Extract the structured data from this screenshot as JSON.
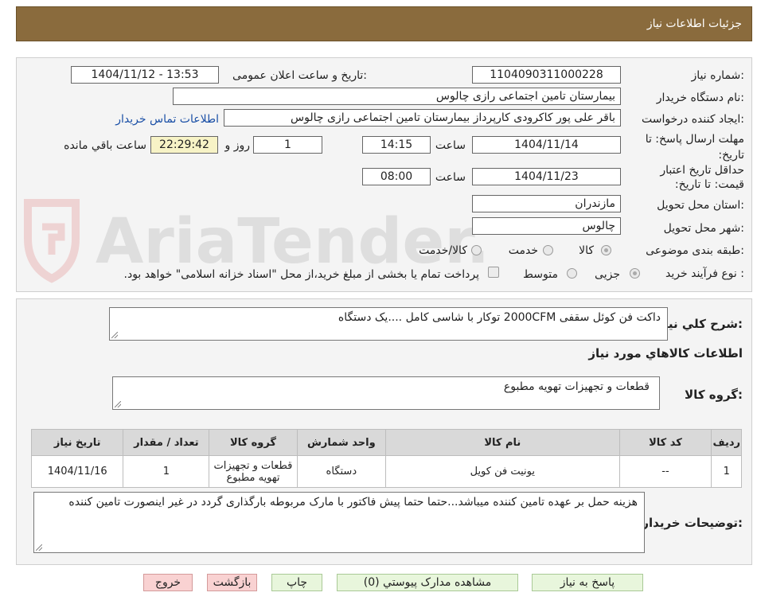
{
  "header": {
    "title": "جزئیات اطلاعات نیاز"
  },
  "watermark": {
    "text": "AriaTender.neT"
  },
  "form": {
    "need_number_label": "شماره نیاز:",
    "need_number": "1104090311000228",
    "announce_label": "تاریخ و ساعت اعلان عمومی:",
    "announce_value": "1404/11/12 - 13:53",
    "buyer_org_label": "نام دستگاه خریدار:",
    "buyer_org": "بیمارستان تامین اجتماعی رازی چالوس",
    "creator_label": "ایجاد کننده درخواست:",
    "creator": "باقر علی پور کاکرودی کارپرداز بیمارستان تامین اجتماعی رازی چالوس",
    "contact_link": "اطلاعات تماس خریدار",
    "deadline_label": "مهلت ارسال پاسخ: تا تاریخ:",
    "deadline_date": "1404/11/14",
    "time_label": "ساعت",
    "deadline_time": "14:15",
    "days": "1",
    "days_label": "روز و",
    "remaining_time": "22:29:42",
    "remaining_label": "ساعت باقي مانده",
    "validity_label": "حداقل تاریخ اعتبار قیمت: تا تاریخ:",
    "validity_date": "1404/11/23",
    "validity_time": "08:00",
    "province_label": "استان محل تحویل:",
    "province": "مازندران",
    "city_label": "شهر محل تحویل:",
    "city": "چالوس",
    "category_label": "طبقه بندی موضوعی:",
    "category_options": [
      "کالا",
      "خدمت",
      "کالا/خدمت"
    ],
    "process_label": "نوع فرآیند خرید :",
    "process_options": [
      "جزیی",
      "متوسط"
    ],
    "payment_note": "پرداخت تمام یا بخشی از مبلغ خرید،از محل \"اسناد خزانه اسلامی\" خواهد بود."
  },
  "summary": {
    "label": "شرح کلي نياز:",
    "text": "داکت فن کوئل سقفی 2000CFM توکار با شاسی کامل ....یک دستگاه",
    "goods_info_title": "اطلاعات کالاهاي مورد نياز",
    "group_label": "گروه کالا:",
    "group_value": "قطعات و تجهیزات تهویه مطبوع"
  },
  "table": {
    "headers": [
      "رديف",
      "کد کالا",
      "نام کالا",
      "واحد شمارش",
      "گروه کالا",
      "تعداد / مقدار",
      "تاریخ نیاز"
    ],
    "rows": [
      [
        "1",
        "--",
        "یونیت فن کویل",
        "دستگاه",
        "قطعات و تجهیزات تهویه مطبوع",
        "1",
        "1404/11/16"
      ]
    ]
  },
  "buyer_notes": {
    "label": "توضیحات خریدار:",
    "text": "هزینه حمل بر عهده تامین کننده میباشد...حتما حتما پیش فاکتور با مارک مربوطه بارگذاری گردد در غیر اینصورت تامین کننده"
  },
  "buttons": {
    "reply": "پاسخ به نیاز",
    "attachments": "مشاهده مدارک پیوستي (0)",
    "print": "چاپ",
    "back": "بازگشت",
    "exit": "خروج"
  },
  "colors": {
    "header_bg": "#8a6b3d",
    "link": "#1a4fa6",
    "remaining_bg": "#f7f3c6",
    "btn_green": "#e8f6dc",
    "btn_pink": "#f9d2d2"
  }
}
